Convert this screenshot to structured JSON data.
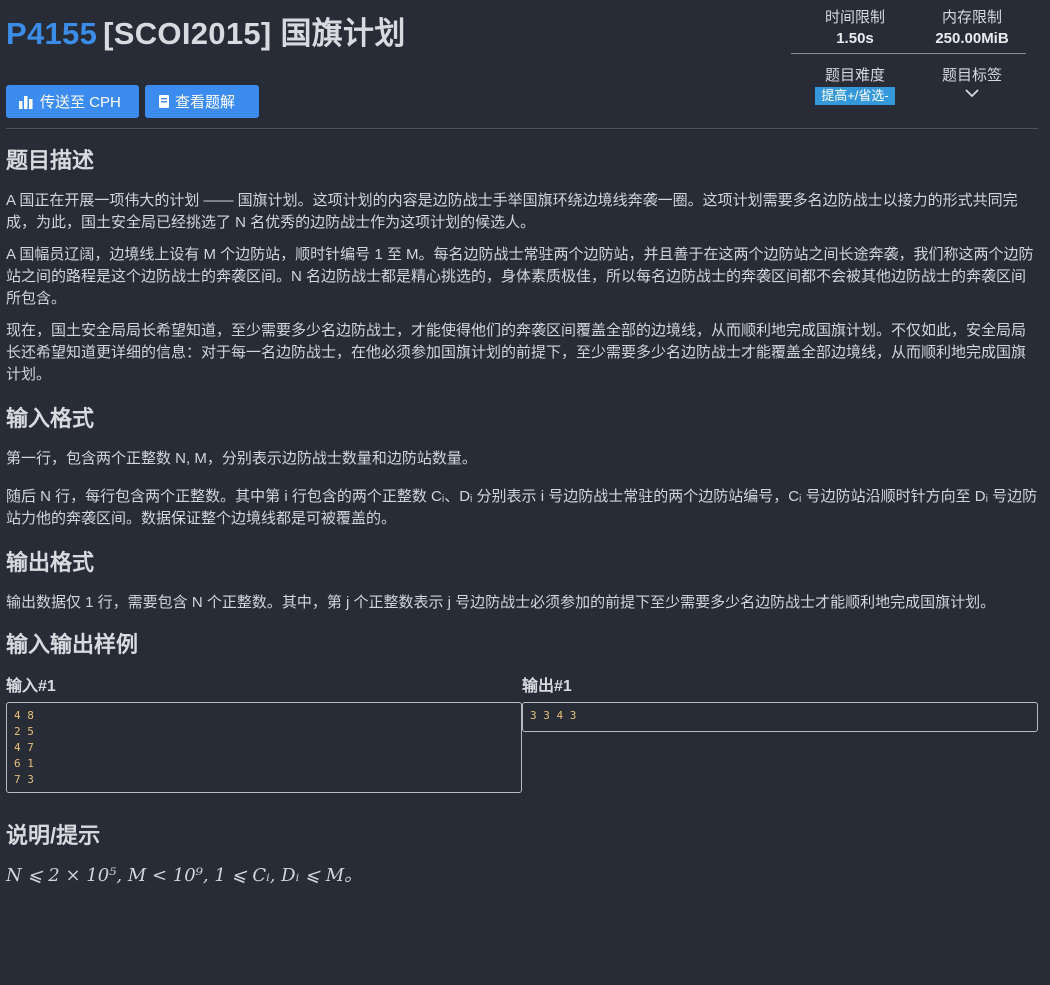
{
  "problem": {
    "id": "P4155",
    "name": "[SCOI2015] 国旗计划"
  },
  "buttons": {
    "cph": "传送至 CPH",
    "solution": "查看题解"
  },
  "meta": {
    "time_label": "时间限制",
    "time_value": "1.50s",
    "mem_label": "内存限制",
    "mem_value": "250.00MiB",
    "diff_label": "题目难度",
    "diff_value": "提高+/省选-",
    "tags_label": "题目标签"
  },
  "sections": {
    "desc_title": "题目描述",
    "desc_p1": "A 国正在开展一项伟大的计划 —— 国旗计划。这项计划的内容是边防战士手举国旗环绕边境线奔袭一圈。这项计划需要多名边防战士以接力的形式共同完成，为此，国土安全局已经挑选了 N 名优秀的边防战士作为这项计划的候选人。",
    "desc_p2": "A 国幅员辽阔，边境线上设有 M 个边防站，顺时针编号 1 至 M。每名边防战士常驻两个边防站，并且善于在这两个边防站之间长途奔袭，我们称这两个边防站之间的路程是这个边防战士的奔袭区间。N 名边防战士都是精心挑选的，身体素质极佳，所以每名边防战士的奔袭区间都不会被其他边防战士的奔袭区间所包含。",
    "desc_p3": "现在，国土安全局局长希望知道，至少需要多少名边防战士，才能使得他们的奔袭区间覆盖全部的边境线，从而顺利地完成国旗计划。不仅如此，安全局局长还希望知道更详细的信息：对于每一名边防战士，在他必须参加国旗计划的前提下，至少需要多少名边防战士才能覆盖全部边境线，从而顺利地完成国旗计划。",
    "input_title": "输入格式",
    "input_p1": "第一行，包含两个正整数 N, M，分别表示边防战士数量和边防站数量。",
    "input_p2": "随后 N 行，每行包含两个正整数。其中第 i 行包含的两个正整数 Cᵢ、Dᵢ 分别表示 i 号边防战士常驻的两个边防站编号，Cᵢ 号边防站沿顺时针方向至 Dᵢ 号边防站力他的奔袭区间。数据保证整个边境线都是可被覆盖的。",
    "output_title": "输出格式",
    "output_p1": "输出数据仅 1 行，需要包含 N 个正整数。其中，第 j 个正整数表示 j 号边防战士必须参加的前提下至少需要多少名边防战士才能顺利地完成国旗计划。",
    "sample_title": "输入输出样例",
    "sample_in_label": "输入#1",
    "sample_in": "4 8\n2 5\n4 7\n6 1\n7 3",
    "sample_out_label": "输出#1",
    "sample_out": "3 3 4 3",
    "hint_title": "说明/提示",
    "hint_text": "N ⩽ 2 × 10⁵, M < 10⁹, 1 ⩽ Cᵢ, Dᵢ ⩽ M。"
  },
  "colors": {
    "background": "#272c36",
    "accent": "#3c8cf0",
    "pid": "#3b8de8",
    "badge": "#3498db"
  },
  "icons": {
    "cph": "bar-chart-icon",
    "solution": "book-icon",
    "tags": "chevron-down-icon"
  }
}
